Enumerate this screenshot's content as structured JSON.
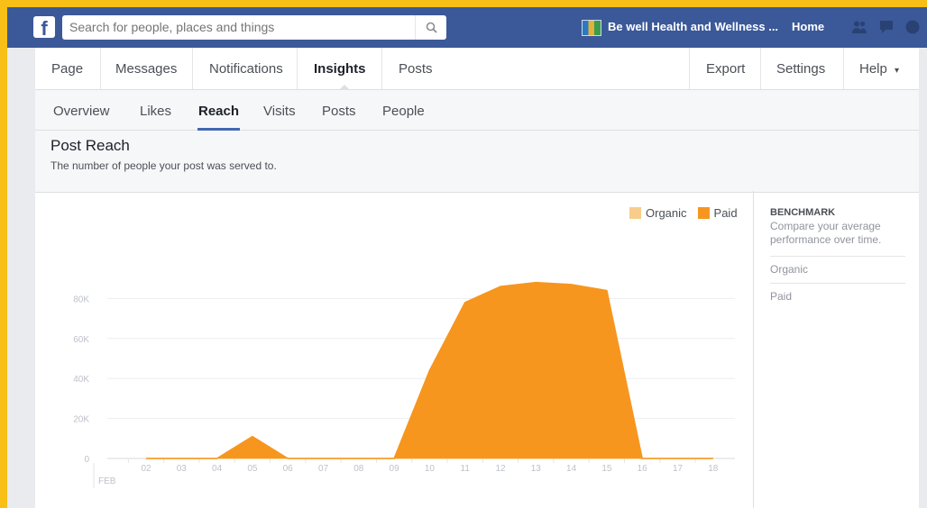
{
  "topbar": {
    "logo": "f",
    "search_placeholder": "Search for people, places and things",
    "page_name": "Be well Health and Wellness ...",
    "home": "Home",
    "icons": [
      "friends-icon",
      "messages-icon",
      "globe-icon"
    ]
  },
  "tabs": {
    "left": [
      "Page",
      "Messages",
      "Notifications",
      "Insights",
      "Posts"
    ],
    "right": [
      "Export",
      "Settings",
      "Help"
    ],
    "help_caret": "▾",
    "active": "Insights"
  },
  "subtabs": {
    "items": [
      "Overview",
      "Likes",
      "Reach",
      "Visits",
      "Posts",
      "People"
    ],
    "active": "Reach"
  },
  "header": {
    "title": "Post Reach",
    "subtitle": "The number of people your post was served to."
  },
  "benchmark": {
    "title": "BENCHMARK",
    "description": "Compare your average performance over time.",
    "items": [
      "Organic",
      "Paid"
    ]
  },
  "colors": {
    "organic": "#f8cd8c",
    "paid": "#f6961e",
    "brand": "#3b5998"
  },
  "chart_data": {
    "type": "area",
    "month_label": "FEB",
    "x": [
      "02",
      "03",
      "04",
      "05",
      "06",
      "07",
      "08",
      "09",
      "10",
      "11",
      "12",
      "13",
      "14",
      "15",
      "16",
      "17",
      "18"
    ],
    "series": [
      {
        "name": "Organic",
        "values": [
          0,
          0,
          0,
          0,
          0,
          0,
          0,
          0,
          0,
          0,
          0,
          0,
          0,
          0,
          0,
          0,
          0
        ]
      },
      {
        "name": "Paid",
        "values": [
          0,
          0,
          0,
          11000,
          0,
          0,
          0,
          0,
          44000,
          78000,
          86000,
          88000,
          87000,
          84000,
          0,
          0,
          0
        ]
      }
    ],
    "yticks": [
      "0",
      "20K",
      "40K",
      "60K",
      "80K"
    ],
    "ylim": [
      0,
      100000
    ],
    "legend": [
      "Organic",
      "Paid"
    ],
    "legend_position": "top-right",
    "grid": true
  }
}
